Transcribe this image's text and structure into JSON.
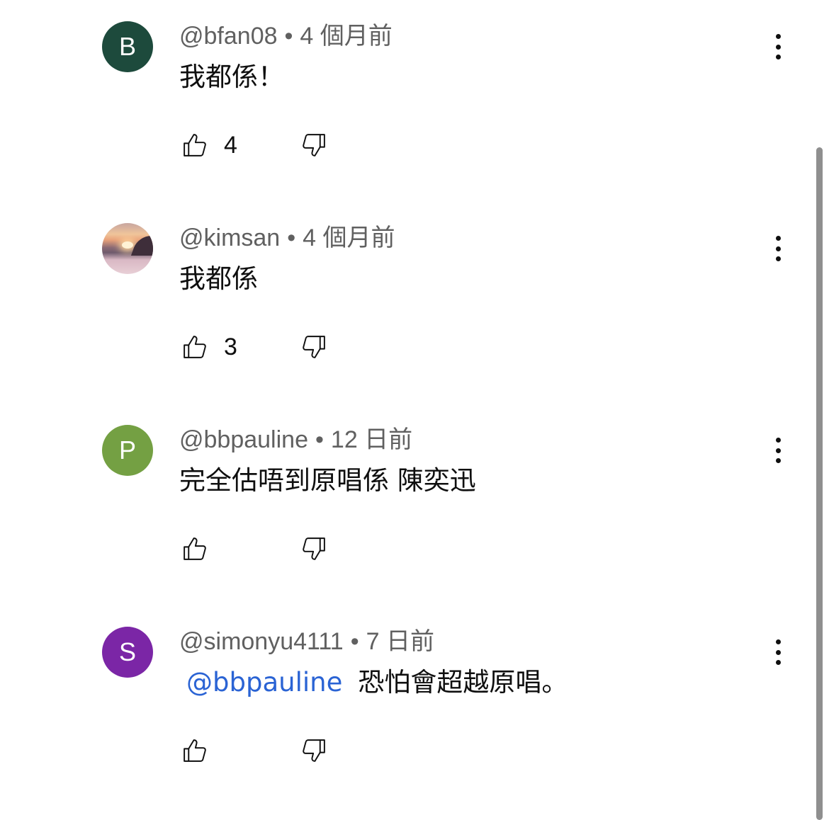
{
  "comments": [
    {
      "handle": "@bfan08",
      "time": "4 個月前",
      "avatar_letter": "B",
      "avatar_color": "#1d4a3c",
      "mention": "",
      "text": "我都係！",
      "likes": "4"
    },
    {
      "handle": "@kimsan",
      "time": "4 個月前",
      "avatar_letter": "",
      "avatar_color": "",
      "mention": "",
      "text": "我都係",
      "likes": "3"
    },
    {
      "handle": "@bbpauline",
      "time": "12 日前",
      "avatar_letter": "P",
      "avatar_color": "#74a043",
      "mention": "",
      "text": "完全估唔到原唱係 陳奕迅",
      "likes": ""
    },
    {
      "handle": "@simonyu4111",
      "time": "7 日前",
      "avatar_letter": "S",
      "avatar_color": "#7b26a6",
      "mention": "@bbpauline",
      "text": "恐怕會超越原唱。",
      "likes": ""
    }
  ],
  "separator": "•",
  "colors": {
    "meta_text": "#606060",
    "mention": "#2a63d4",
    "text": "#0f0f0f"
  },
  "icons": {
    "like": "thumbs-up-icon",
    "dislike": "thumbs-down-icon",
    "more": "more-vert-icon"
  }
}
